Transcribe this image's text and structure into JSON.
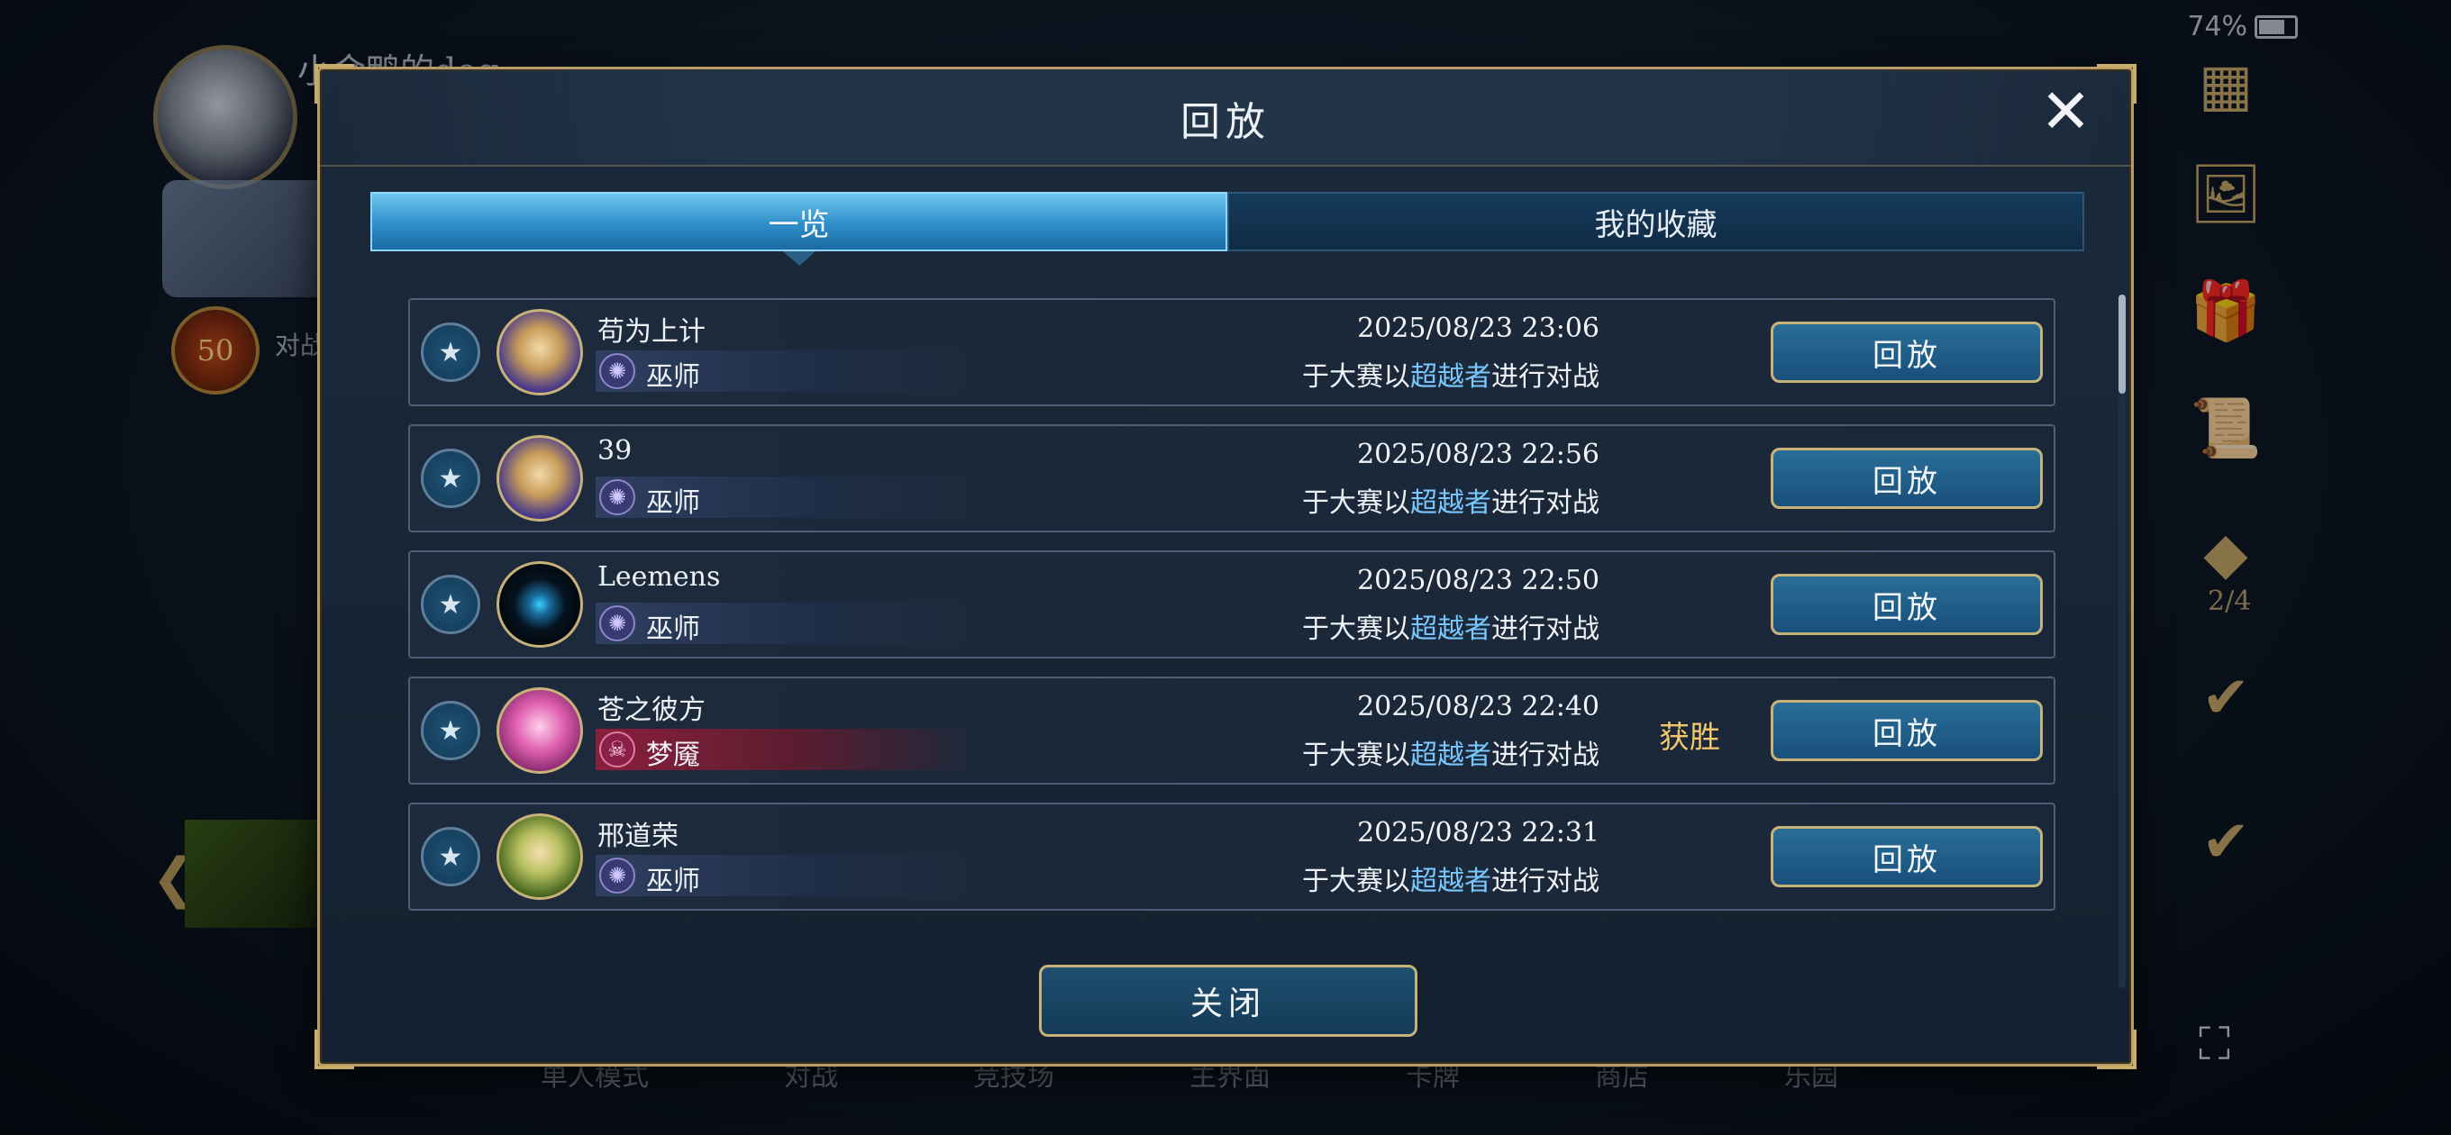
{
  "status": {
    "battery": "74%"
  },
  "background": {
    "player_name": "小金鸭的dog",
    "rank_level": "50",
    "progress_text": "对战进行中",
    "bottom_nav": [
      "单人模式",
      "对战",
      "竞技场",
      "主界面",
      "卡牌",
      "商店",
      "乐园"
    ],
    "side_counter": "2/4"
  },
  "dialog": {
    "title": "回放",
    "tabs": [
      {
        "label": "一览",
        "active": true
      },
      {
        "label": "我的收藏",
        "active": false
      }
    ],
    "replays": [
      {
        "name": "苟为上计",
        "class": "巫师",
        "datetime": "2025/08/23  23:06",
        "desc_pre": "于大赛以",
        "desc_hl": "超越者",
        "desc_post": "进行对战",
        "result": "",
        "button": "回放",
        "portrait": "witch-blonde"
      },
      {
        "name": "39",
        "class": "巫师",
        "datetime": "2025/08/23  22:56",
        "desc_pre": "于大赛以",
        "desc_hl": "超越者",
        "desc_post": "进行对战",
        "result": "",
        "button": "回放",
        "portrait": "witch-blonde"
      },
      {
        "name": "Leemens",
        "class": "巫师",
        "datetime": "2025/08/23  22:50",
        "desc_pre": "于大赛以",
        "desc_hl": "超越者",
        "desc_post": "进行对战",
        "result": "",
        "button": "回放",
        "portrait": "emblem-dark"
      },
      {
        "name": "苍之彼方",
        "class": "梦魇",
        "datetime": "2025/08/23  22:40",
        "desc_pre": "于大赛以",
        "desc_hl": "超越者",
        "desc_post": "进行对战",
        "result": "获胜",
        "button": "回放",
        "portrait": "nightmare-pink"
      },
      {
        "name": "邢道荣",
        "class": "巫师",
        "datetime": "2025/08/23  22:31",
        "desc_pre": "于大赛以",
        "desc_hl": "超越者",
        "desc_post": "进行对战",
        "result": "",
        "button": "回放",
        "portrait": "elf-green"
      }
    ],
    "close_button": "关闭"
  },
  "colors": {
    "accent_blue": "#2f8ec9",
    "gold_border": "#c7b27a",
    "highlight_text": "#78c8ff",
    "win_text": "#f2c66a",
    "nightmare_red": "#8a1f48"
  },
  "icons": {
    "favorite": "bookmark-star-icon",
    "wizard_class": "wizard-class-icon",
    "nightmare_class": "nightmare-class-icon",
    "close": "close-icon"
  }
}
